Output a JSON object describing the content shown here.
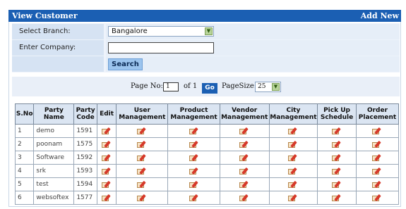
{
  "header": {
    "title": "View Customer",
    "add_new": "Add New"
  },
  "form": {
    "branch_label": "Select Branch:",
    "branch_value": "Bangalore",
    "company_label": "Enter Company:",
    "company_value": "",
    "search_label": "Search"
  },
  "pager": {
    "page_no_label": "Page No:",
    "page_value": "1",
    "of_label": "of 1",
    "go_label": "Go",
    "page_size_label": "PageSize:",
    "page_size_value": "25"
  },
  "table": {
    "columns": [
      "S.No",
      "Party Name",
      "Party Code",
      "Edit",
      "User Management",
      "Product Management",
      "Vendor Management",
      "City Management",
      "Pick Up Schedule",
      "Order Placement"
    ],
    "action_icon": "edit-icon",
    "rows": [
      {
        "sno": "1",
        "name": "demo",
        "code": "1591"
      },
      {
        "sno": "2",
        "name": "poonam",
        "code": "1575"
      },
      {
        "sno": "3",
        "name": "Software",
        "code": "1592"
      },
      {
        "sno": "4",
        "name": "srk",
        "code": "1593"
      },
      {
        "sno": "5",
        "name": "test",
        "code": "1594"
      },
      {
        "sno": "6",
        "name": "websoftex",
        "code": "1577"
      }
    ]
  }
}
